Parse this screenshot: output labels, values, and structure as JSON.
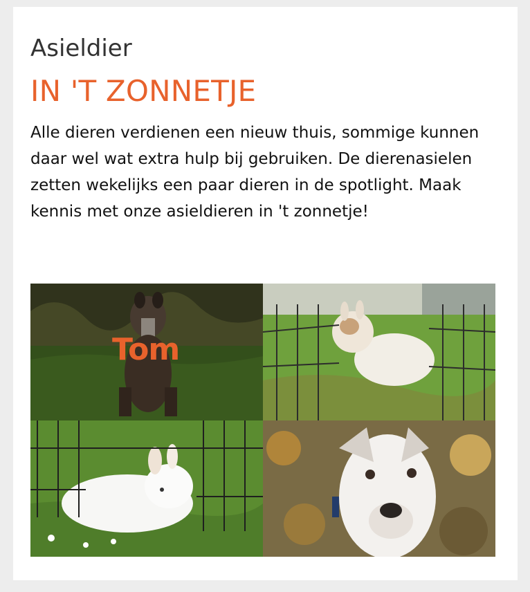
{
  "header": {
    "kicker": "Asieldier",
    "title": "IN 'T ZONNETJE",
    "intro": "Alle dieren verdienen een nieuw thuis, sommige kunnen daar wel wat extra hulp bij gebruiken. De dierenasielen zetten wekelijks een paar dieren in de spotlight. Maak kennis met onze asieldieren in 't zonnetje!"
  },
  "animals": [
    {
      "name": "Tom",
      "kind": "dog",
      "favorite_icon": "heart-icon",
      "favorite_color": "#ffffff"
    },
    {
      "name": "",
      "kind": "rabbit"
    },
    {
      "name": "",
      "kind": "rabbit"
    },
    {
      "name": "",
      "kind": "dog"
    }
  ],
  "colors": {
    "accent": "#e8622c",
    "page_background": "#ededed",
    "card_background": "#ffffff"
  }
}
